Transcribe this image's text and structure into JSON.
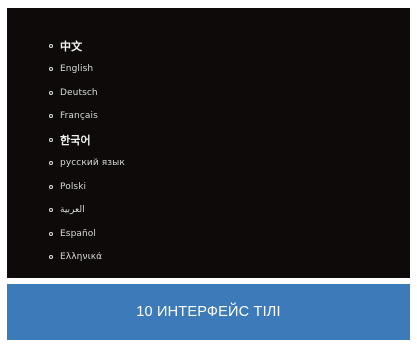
{
  "languages": [
    {
      "label": "中文"
    },
    {
      "label": "English"
    },
    {
      "label": "Deutsch"
    },
    {
      "label": "Français"
    },
    {
      "label": "한국어"
    },
    {
      "label": "русский язык"
    },
    {
      "label": "Polski"
    },
    {
      "label": "العربية"
    },
    {
      "label": "Español"
    },
    {
      "label": "Ελληνικά"
    }
  ],
  "caption": {
    "text": "10 ИНТЕРФЕЙС ТІЛІ"
  },
  "colors": {
    "screen_background": "#0d0a09",
    "caption_background": "#3d7ab9",
    "text": "#d8d8d8"
  }
}
